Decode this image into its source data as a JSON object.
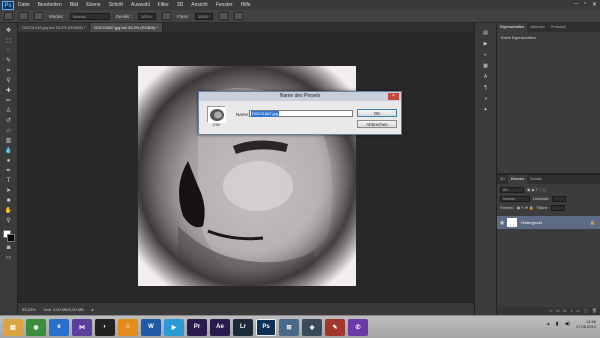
{
  "app": {
    "logo": "Ps",
    "menu": [
      "Datei",
      "Bearbeiten",
      "Bild",
      "Ebene",
      "Schrift",
      "Auswahl",
      "Filter",
      "3D",
      "Ansicht",
      "Fenster",
      "Hilfe"
    ]
  },
  "options_bar": {
    "modus_label": "Modus:",
    "modus_value": "Normal",
    "deckkraft_label": "Deckkr.:",
    "deckkraft_value": "100%",
    "fluss_label": "Fluss:",
    "fluss_value": "100%"
  },
  "tabs": [
    {
      "label": "DSC01418.jpg bei 33,3% (RGB/8) *",
      "active": false
    },
    {
      "label": "DSC01867.jpg bei 33,3% (RGB/8) *",
      "active": true
    }
  ],
  "dialog": {
    "title": "Name des Pinsels",
    "name_label": "Name:",
    "name_value": "DSC01867.jpg",
    "thumb_size": "1759",
    "ok_label": "OK",
    "cancel_label": "Abbrechen",
    "close_glyph": "×"
  },
  "status_bar": {
    "zoom": "33,33%",
    "doc_info": "Dok: 3,00 MB/3,00 MB"
  },
  "properties_panel": {
    "tabs": [
      "Eigenschaften",
      "Aktionen",
      "Protokoll"
    ],
    "body_text": "Keine Eigenschaften"
  },
  "layers_panel": {
    "tabs": [
      "3D",
      "Ebenen",
      "Kanäle"
    ],
    "kind_label": "Art",
    "mode_value": "Normal",
    "opacity_label": "Deckkraft:",
    "fill_label": "Fläche:",
    "fixieren_label": "Fixieren:",
    "layer_name": "Hintergrund"
  },
  "taskbar": {
    "apps": [
      {
        "name": "file-explorer",
        "glyph": "▤",
        "color": "#d9a441",
        "active": false
      },
      {
        "name": "chrome",
        "glyph": "◉",
        "color": "#3a8e3a",
        "active": false
      },
      {
        "name": "internet-explorer",
        "glyph": "e",
        "color": "#2a6fc9",
        "active": false
      },
      {
        "name": "visual-studio",
        "glyph": "⋈",
        "color": "#5a3f9c",
        "active": false
      },
      {
        "name": "media-center",
        "glyph": "◐",
        "color": "#222222",
        "active": false
      },
      {
        "name": "chat-app",
        "glyph": "☺",
        "color": "#e38d1d",
        "active": false
      },
      {
        "name": "word",
        "glyph": "W",
        "color": "#1e5aa6",
        "active": false
      },
      {
        "name": "media-player",
        "glyph": "▶",
        "color": "#2a9bd5",
        "active": false
      },
      {
        "name": "premiere",
        "glyph": "Pr",
        "color": "#2b1a4e",
        "active": false
      },
      {
        "name": "after-effects",
        "glyph": "Ae",
        "color": "#2b1a4e",
        "active": false
      },
      {
        "name": "lightroom",
        "glyph": "Lr",
        "color": "#1d2a3a",
        "active": false
      },
      {
        "name": "photoshop",
        "glyph": "Ps",
        "color": "#0b2f55",
        "active": true
      },
      {
        "name": "network",
        "glyph": "⊞",
        "color": "#4b6a8a",
        "active": false
      },
      {
        "name": "game",
        "glyph": "◆",
        "color": "#3a4a5a",
        "active": false
      },
      {
        "name": "paint",
        "glyph": "✎",
        "color": "#a2362b",
        "active": false
      },
      {
        "name": "viber",
        "glyph": "✆",
        "color": "#6b3aa8",
        "active": false
      }
    ],
    "clock_time": "11:56",
    "clock_date": "27.08.2013"
  }
}
